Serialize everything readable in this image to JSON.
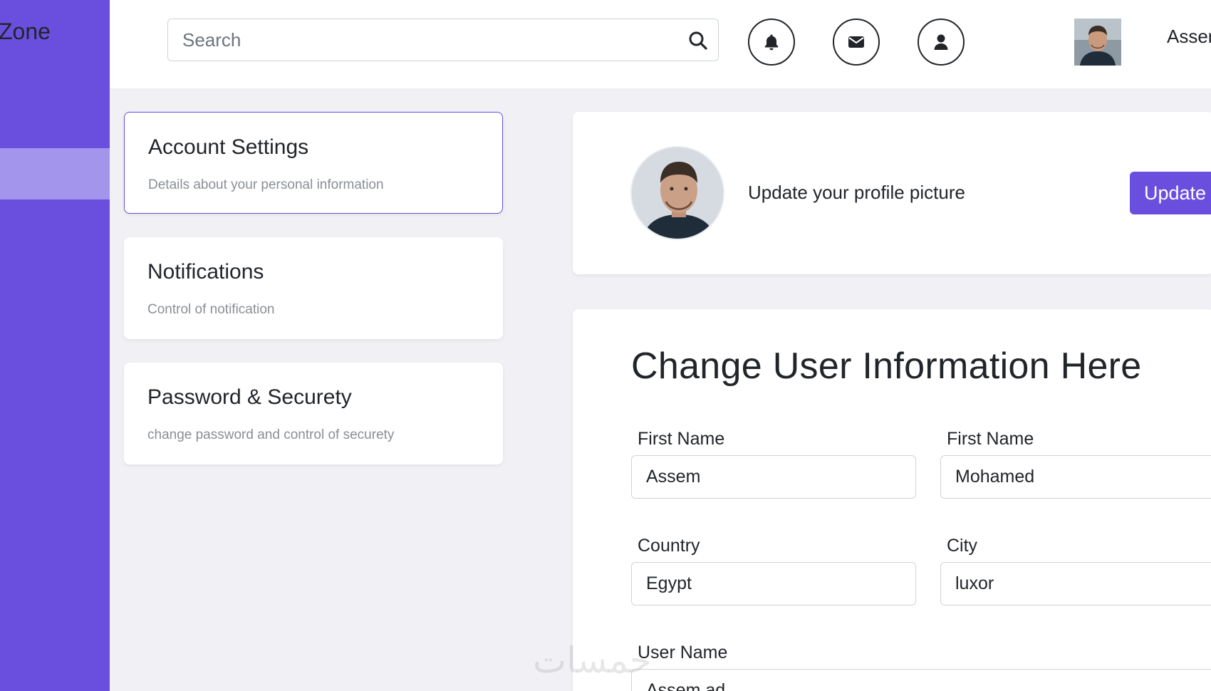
{
  "sidebar": {
    "brand": "Zone"
  },
  "header": {
    "search_placeholder": "Search",
    "icons": [
      "bell-icon",
      "envelope-icon",
      "user-icon"
    ],
    "user_name": "Asser"
  },
  "settings_menu": [
    {
      "title": "Account Settings",
      "description": "Details about your personal information",
      "active": true
    },
    {
      "title": "Notifications",
      "description": "Control of notification",
      "active": false
    },
    {
      "title": "Password & Securety",
      "description": "change password and control of securety",
      "active": false
    }
  ],
  "profile_picture": {
    "text": "Update your profile picture",
    "button": "Update"
  },
  "user_info": {
    "heading": "Change User Information Here",
    "fields": [
      {
        "label": "First Name",
        "value": "Assem"
      },
      {
        "label": "First Name",
        "value": "Mohamed"
      },
      {
        "label": "Country",
        "value": "Egypt"
      },
      {
        "label": "City",
        "value": "luxor"
      },
      {
        "label": "User Name",
        "value": "Assem ad"
      }
    ]
  },
  "watermark": "خمسات",
  "colors": {
    "accent": "#6a4fdf",
    "sidebar_active": "#a394ec",
    "background": "#f0f0f5"
  }
}
